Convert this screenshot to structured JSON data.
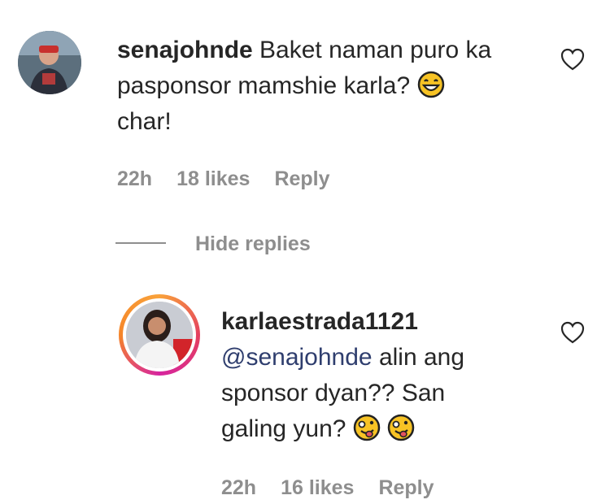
{
  "comment": {
    "username": "senajohnde",
    "text_line1": "Baket naman puro ka",
    "text_line2": "pasponsor mamshie karla?",
    "text_line3": "char!",
    "time": "22h",
    "likes": "18 likes",
    "reply_label": "Reply"
  },
  "hide_replies_label": "Hide replies",
  "reply": {
    "username": "karlaestrada1121",
    "mention": "@senajohnde",
    "text_line1_rest": " alin ang",
    "text_line2": "sponsor dyan?? San",
    "text_line3": "galing yun?",
    "time": "22h",
    "likes": "16 likes",
    "reply_label": "Reply"
  },
  "colors": {
    "text": "#262626",
    "meta": "#8e8e8e",
    "mention": "#2f3e6e",
    "emoji_yellow": "#f7c325"
  }
}
